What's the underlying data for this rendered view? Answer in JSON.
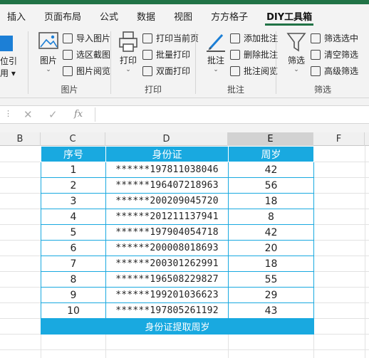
{
  "tabs": [
    "插入",
    "页面布局",
    "公式",
    "数据",
    "视图",
    "方方格子",
    "DIY工具箱"
  ],
  "ribbon": {
    "partial_left": {
      "line1": "位引",
      "line2": "用 ▾"
    },
    "image_group": {
      "label": "图片",
      "big": "图片",
      "items": [
        "导入图片",
        "选区截图",
        "图片阅览"
      ]
    },
    "print_group": {
      "label": "打印",
      "big": "打印",
      "items": [
        "打印当前页",
        "批量打印",
        "双面打印"
      ]
    },
    "comment_group": {
      "label": "批注",
      "big": "批注",
      "items": [
        "添加批注",
        "删除批注",
        "批注阅览"
      ]
    },
    "filter_group": {
      "label": "筛选",
      "big": "筛选",
      "items": [
        "筛选选中",
        "清空筛选",
        "高级筛选"
      ]
    }
  },
  "formula_bar": {
    "cancel": "✕",
    "confirm": "✓",
    "fx": "fx",
    "value": ""
  },
  "columns": [
    "B",
    "C",
    "D",
    "E",
    "F"
  ],
  "table": {
    "headers": [
      "序号",
      "身份证",
      "周岁"
    ],
    "rows": [
      [
        "1",
        "******197811038046",
        "42"
      ],
      [
        "2",
        "******196407218963",
        "56"
      ],
      [
        "3",
        "******200209045720",
        "18"
      ],
      [
        "4",
        "******201211137941",
        "8"
      ],
      [
        "5",
        "******197904054718",
        "42"
      ],
      [
        "6",
        "******200008018693",
        "20"
      ],
      [
        "7",
        "******200301262991",
        "18"
      ],
      [
        "8",
        "******196508229827",
        "55"
      ],
      [
        "9",
        "******199201036623",
        "29"
      ],
      [
        "10",
        "******197805261192",
        "43"
      ]
    ],
    "footer": "身份证提取周岁"
  },
  "colors": {
    "accent": "#217346",
    "table_blue": "#19a9e0"
  }
}
